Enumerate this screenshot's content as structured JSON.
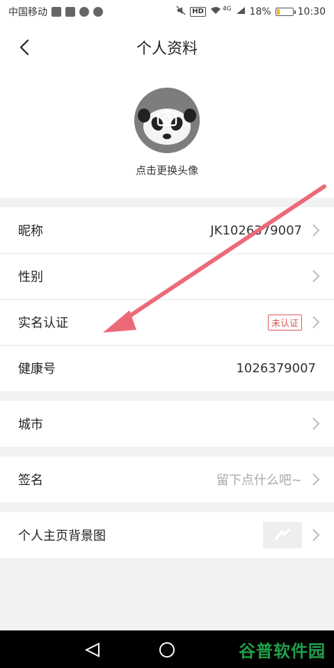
{
  "status_bar": {
    "carrier": "中国移动",
    "hd_label": "HD",
    "network": "4G",
    "battery_percent": "18%",
    "time": "10:30"
  },
  "header": {
    "title": "个人资料"
  },
  "avatar": {
    "hint": "点击更换头像"
  },
  "rows": {
    "nickname": {
      "label": "昵称",
      "value": "JK1026379007"
    },
    "gender": {
      "label": "性别"
    },
    "realname": {
      "label": "实名认证",
      "badge": "未认证"
    },
    "health_id": {
      "label": "健康号",
      "value": "1026379007"
    },
    "city": {
      "label": "城市"
    },
    "signature": {
      "label": "签名",
      "placeholder": "留下点什么吧~"
    },
    "background": {
      "label": "个人主页背景图"
    }
  },
  "watermark": "谷普软件园",
  "colors": {
    "accent_red": "#e25555",
    "arrow_red": "#ea6b77",
    "battery_yellow": "#f5b400",
    "watermark_green": "#1fa04a"
  },
  "icons": {
    "back": "chevron-left-icon",
    "camera": "camera-icon",
    "chevron": "chevron-right-icon",
    "nav_back": "triangle-back-icon",
    "nav_home": "circle-home-icon"
  }
}
